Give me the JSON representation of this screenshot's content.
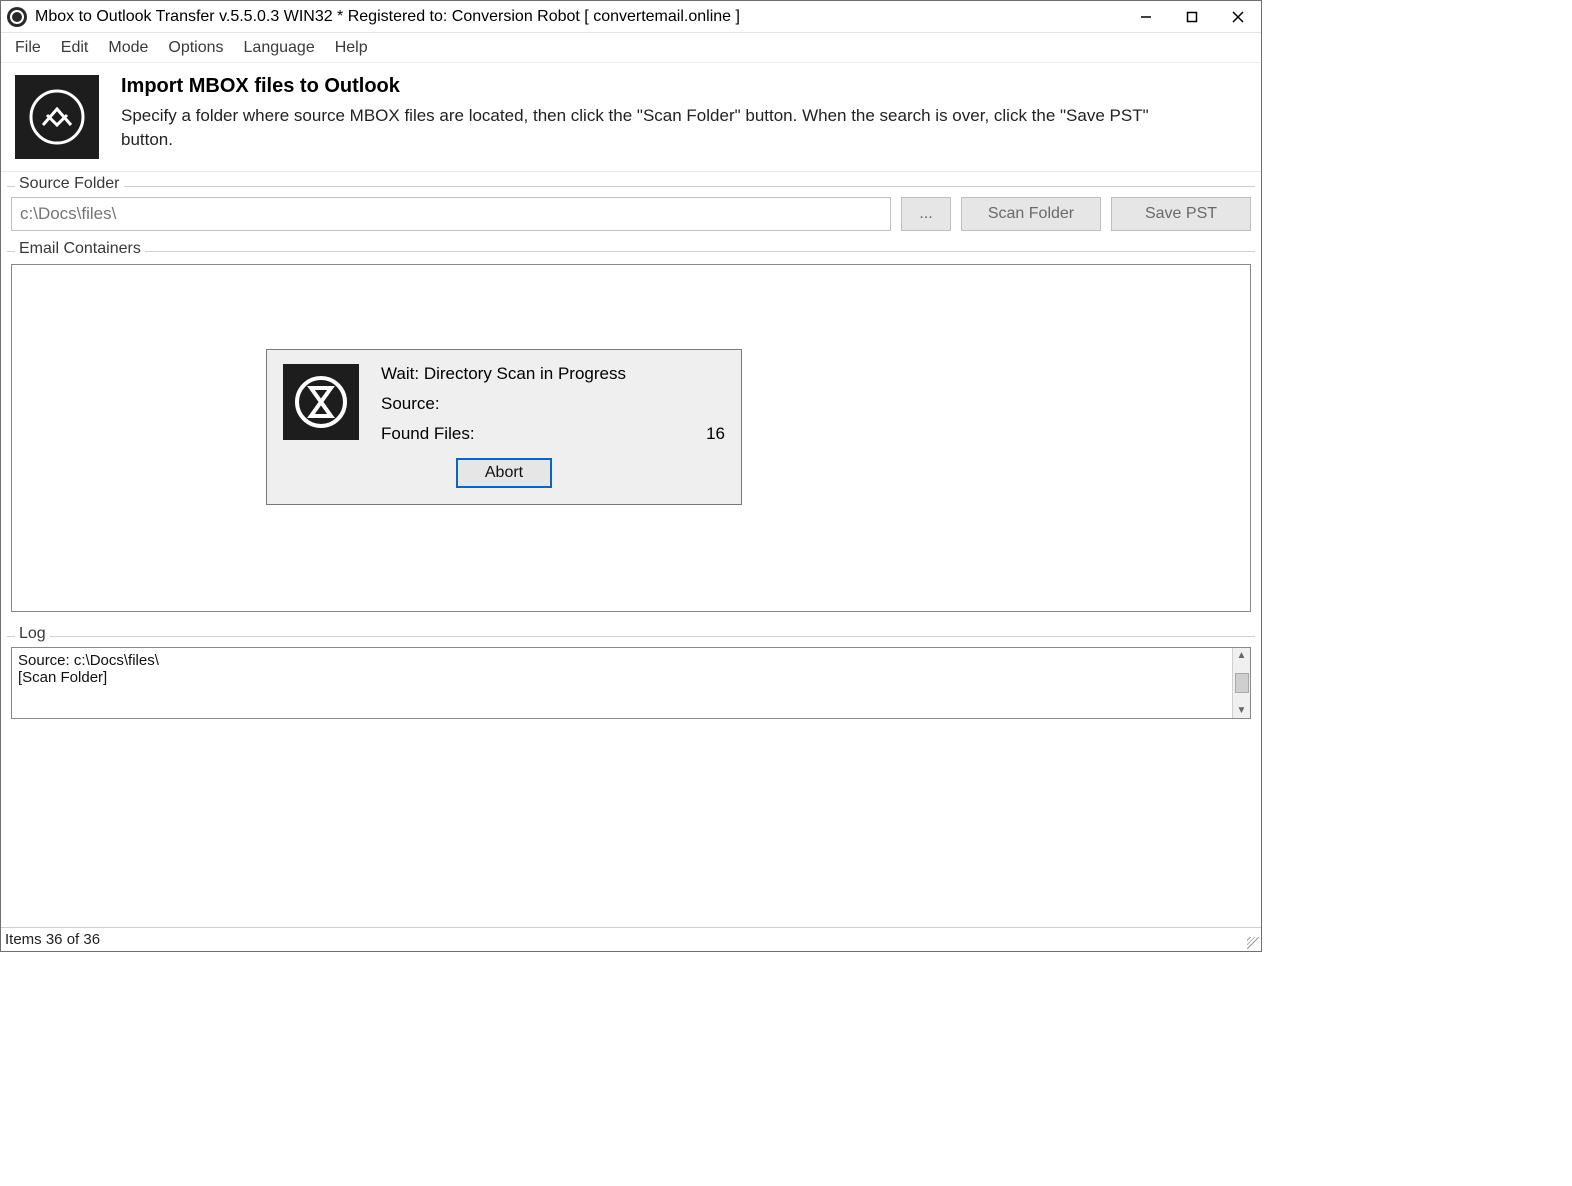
{
  "window": {
    "title": "Mbox to Outlook Transfer v.5.5.0.3 WIN32 * Registered to: Conversion Robot [ convertemail.online ]"
  },
  "menu": {
    "items": [
      "File",
      "Edit",
      "Mode",
      "Options",
      "Language",
      "Help"
    ]
  },
  "header": {
    "title": "Import MBOX files to Outlook",
    "description": "Specify a folder where source MBOX files are located, then click the \"Scan Folder\" button. When the search is over, click the \"Save PST\" button."
  },
  "source": {
    "legend": "Source Folder",
    "path_placeholder": "c:\\Docs\\files\\",
    "browse_label": "...",
    "scan_label": "Scan Folder",
    "save_label": "Save PST"
  },
  "containers": {
    "legend": "Email Containers"
  },
  "dialog": {
    "title": "Wait: Directory Scan in Progress",
    "source_label": "Source:",
    "source_value": "",
    "found_label": "Found Files:",
    "found_value": "16",
    "abort_label": "Abort"
  },
  "log": {
    "legend": "Log",
    "text": "Source: c:\\Docs\\files\\\n[Scan Folder]"
  },
  "status": {
    "text": "Items 36 of 36"
  }
}
